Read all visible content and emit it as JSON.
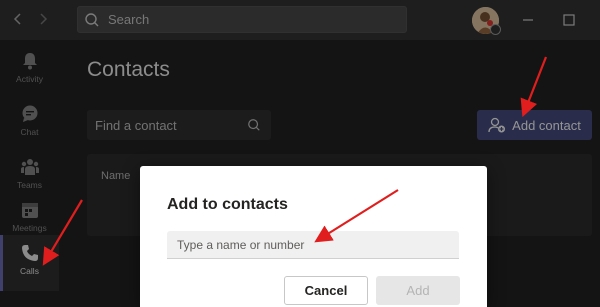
{
  "titlebar": {
    "search_placeholder": "Search"
  },
  "rail": {
    "items": [
      {
        "label": "Activity",
        "icon": "bell-icon"
      },
      {
        "label": "Chat",
        "icon": "chat-icon"
      },
      {
        "label": "Teams",
        "icon": "teams-icon"
      },
      {
        "label": "Meetings",
        "icon": "calendar-icon"
      },
      {
        "label": "Calls",
        "icon": "phone-icon"
      }
    ],
    "active": "Calls"
  },
  "main": {
    "title": "Contacts",
    "search_placeholder": "Find a contact",
    "add_contact_label": "Add contact",
    "table_header_name": "Name"
  },
  "dialog": {
    "title": "Add to contacts",
    "input_placeholder": "Type a name or number",
    "cancel_label": "Cancel",
    "add_label": "Add"
  },
  "colors": {
    "accent": "#6264a7",
    "add_contact_bg": "#3f4673",
    "annotation_arrow": "#e01e1e"
  }
}
